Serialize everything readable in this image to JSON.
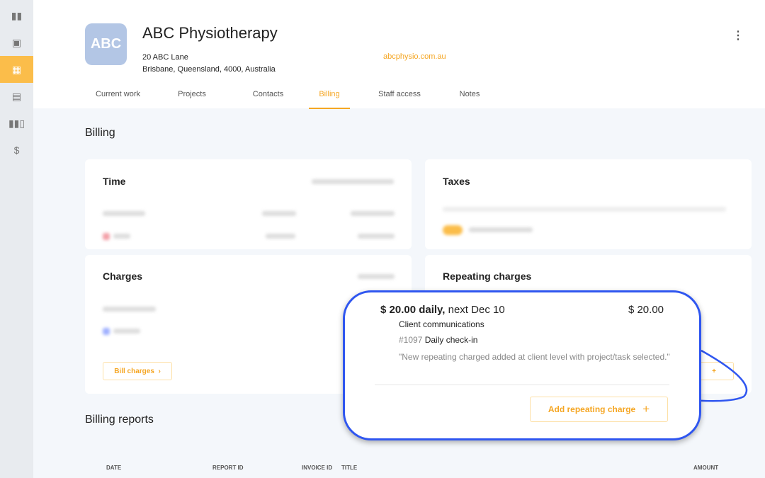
{
  "sidebar": {
    "items": [
      {
        "icon": "timeline-icon"
      },
      {
        "icon": "calendar-icon"
      },
      {
        "icon": "building-icon",
        "active": true
      },
      {
        "icon": "clipboard-icon"
      },
      {
        "icon": "bar-chart-icon"
      },
      {
        "icon": "dollar-icon",
        "glyph": "$"
      }
    ]
  },
  "client": {
    "logo": "ABC",
    "name": "ABC Physiotherapy",
    "address_line1": "20 ABC Lane",
    "address_line2": "Brisbane, Queensland, 4000, Australia",
    "website": "abcphysio.com.au"
  },
  "tabs": [
    "Current work",
    "Projects",
    "Contacts",
    "Billing",
    "Staff access",
    "Notes"
  ],
  "active_tab": "Billing",
  "billing": {
    "heading": "Billing",
    "time": {
      "title": "Time"
    },
    "charges": {
      "title": "Charges",
      "bill_button": "Bill charges"
    },
    "taxes": {
      "title": "Taxes"
    },
    "repeating": {
      "title": "Repeating charges"
    }
  },
  "callout": {
    "amount_bold": "$ 20.00 daily,",
    "next": " next Dec 10",
    "total": "$ 20.00",
    "client": "Client communications",
    "task_id": "#1097",
    "task_name": "Daily check-in",
    "note": "\"New repeating charged added at client level with project/task selected.\"",
    "add_button": "Add repeating charge"
  },
  "reports": {
    "heading": "Billing reports",
    "columns": [
      "DATE",
      "REPORT ID",
      "INVOICE ID",
      "TITLE",
      "AMOUNT"
    ]
  },
  "colors": {
    "accent": "#f5a623",
    "callout": "#2f56f0"
  }
}
